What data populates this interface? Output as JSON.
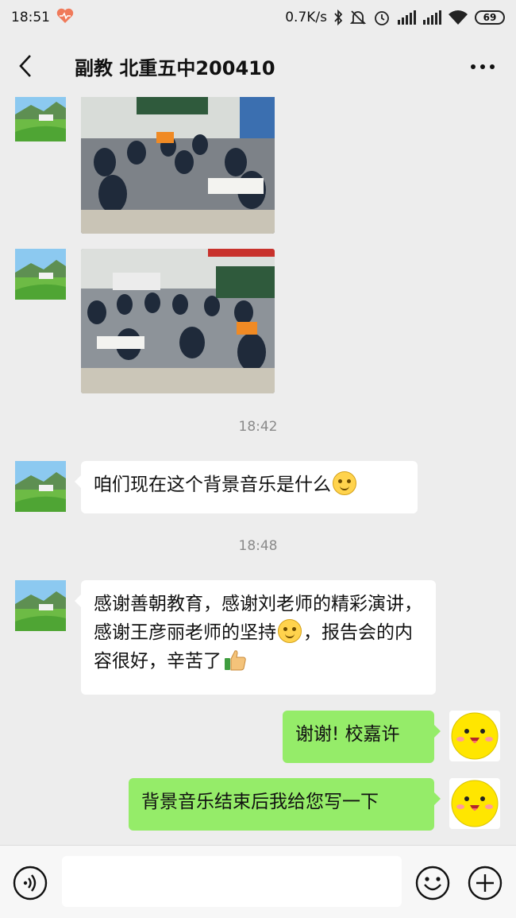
{
  "status_bar": {
    "time": "18:51",
    "net_speed": "0.7K/s",
    "battery": "69"
  },
  "header": {
    "title": "副教 北重五中200410"
  },
  "messages": {
    "time_1": "18:42",
    "msg_1": "咱们现在这个背景音乐是什么",
    "time_2": "18:48",
    "msg_2": "感谢善朝教育，感谢刘老师的精彩演讲，感谢王彦丽老师的坚持",
    "msg_2_tail": "，报告会的内容很好，辛苦了",
    "msg_3": "谢谢!   校嘉许",
    "msg_4": "背景音乐结束后我给您写一下"
  },
  "input": {
    "placeholder": ""
  },
  "icons": {
    "back": "back-arrow-icon",
    "more": "more-dots-icon",
    "voice": "voice-icon",
    "emoji": "emoji-icon",
    "plus": "plus-icon"
  },
  "colors": {
    "background": "#ededed",
    "bubble_self": "#95ec69",
    "bubble_other": "#ffffff"
  }
}
